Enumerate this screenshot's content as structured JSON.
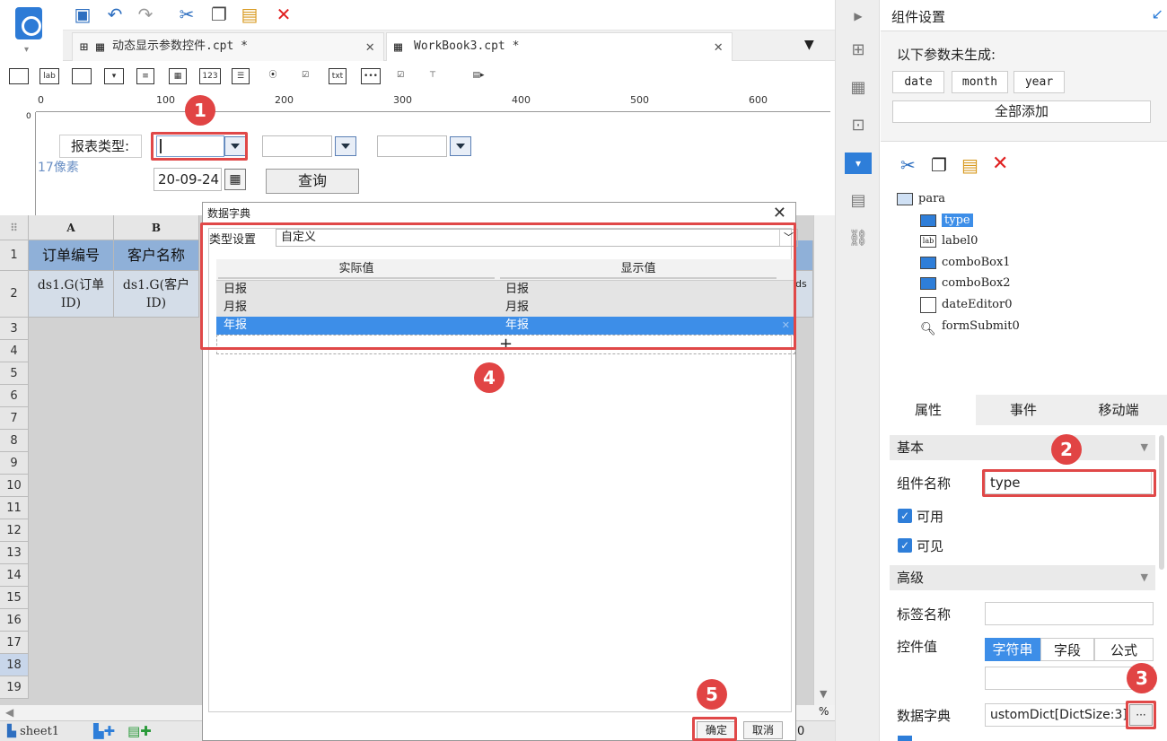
{
  "window": {
    "accent": "#2e7ed9",
    "highlight": "#e04848"
  },
  "tabs": [
    {
      "label": "动态显示参数控件.cpt *",
      "icon": "grid-icon"
    },
    {
      "label": "WorkBook3.cpt *",
      "icon": "grid-icon"
    }
  ],
  "widget_bar": {
    "labels": [
      "lab",
      "123",
      "txt"
    ]
  },
  "ruler": {
    "ticks": [
      "0",
      "100",
      "200",
      "300",
      "400",
      "500",
      "600"
    ]
  },
  "param_pane": {
    "label": "报表类型:",
    "size_hint": "17像素",
    "date_value": "20-09-24",
    "query_button": "查询"
  },
  "grid": {
    "columns": [
      "A",
      "B"
    ],
    "header_row": [
      "订单编号",
      "客户名称"
    ],
    "data_row": [
      "ds1.G(订单ID)",
      "ds1.G(客户ID)"
    ],
    "row_numbers": [
      "1",
      "2",
      "3",
      "4",
      "5",
      "6",
      "7",
      "8",
      "9",
      "10",
      "11",
      "12",
      "13",
      "14",
      "15",
      "16",
      "17",
      "18",
      "19"
    ],
    "right_fragment": "ds"
  },
  "dialog": {
    "title": "数据字典",
    "type_label": "类型设置",
    "type_value": "自定义",
    "col_actual": "实际值",
    "col_display": "显示值",
    "rows": [
      {
        "actual": "日报",
        "display": "日报"
      },
      {
        "actual": "月报",
        "display": "月报"
      },
      {
        "actual": "年报",
        "display": "年报"
      }
    ],
    "add": "+",
    "ok": "确定",
    "cancel": "取消"
  },
  "badges": [
    "1",
    "2",
    "3",
    "4",
    "5"
  ],
  "status": {
    "sheet": "sheet1",
    "zoom": "0"
  },
  "panel": {
    "title": "组件设置",
    "notice": "以下参数未生成:",
    "chips": [
      "date",
      "month",
      "year"
    ],
    "add_all": "全部添加",
    "tree": [
      {
        "label": "para",
        "icon": "form-icon"
      },
      {
        "label": "type",
        "icon": "combobox-icon"
      },
      {
        "label": "label0",
        "icon": "label-icon"
      },
      {
        "label": "comboBox1",
        "icon": "combobox-icon"
      },
      {
        "label": "comboBox2",
        "icon": "combobox-icon"
      },
      {
        "label": "dateEditor0",
        "icon": "calendar-icon"
      },
      {
        "label": "formSubmit0",
        "icon": "submit-icon"
      }
    ],
    "tabs": [
      "属性",
      "事件",
      "移动端"
    ],
    "sec_basic": "基本",
    "name_label": "组件名称",
    "name_value": "type",
    "enabled": "可用",
    "visible": "可见",
    "sec_adv": "高级",
    "tag_label": "标签名称",
    "value_label": "控件值",
    "value_types": [
      "字符串",
      "字段",
      "公式"
    ],
    "dict_label": "数据字典",
    "dict_value": "ustomDict[DictSize:3]",
    "dict_btn": "···"
  }
}
